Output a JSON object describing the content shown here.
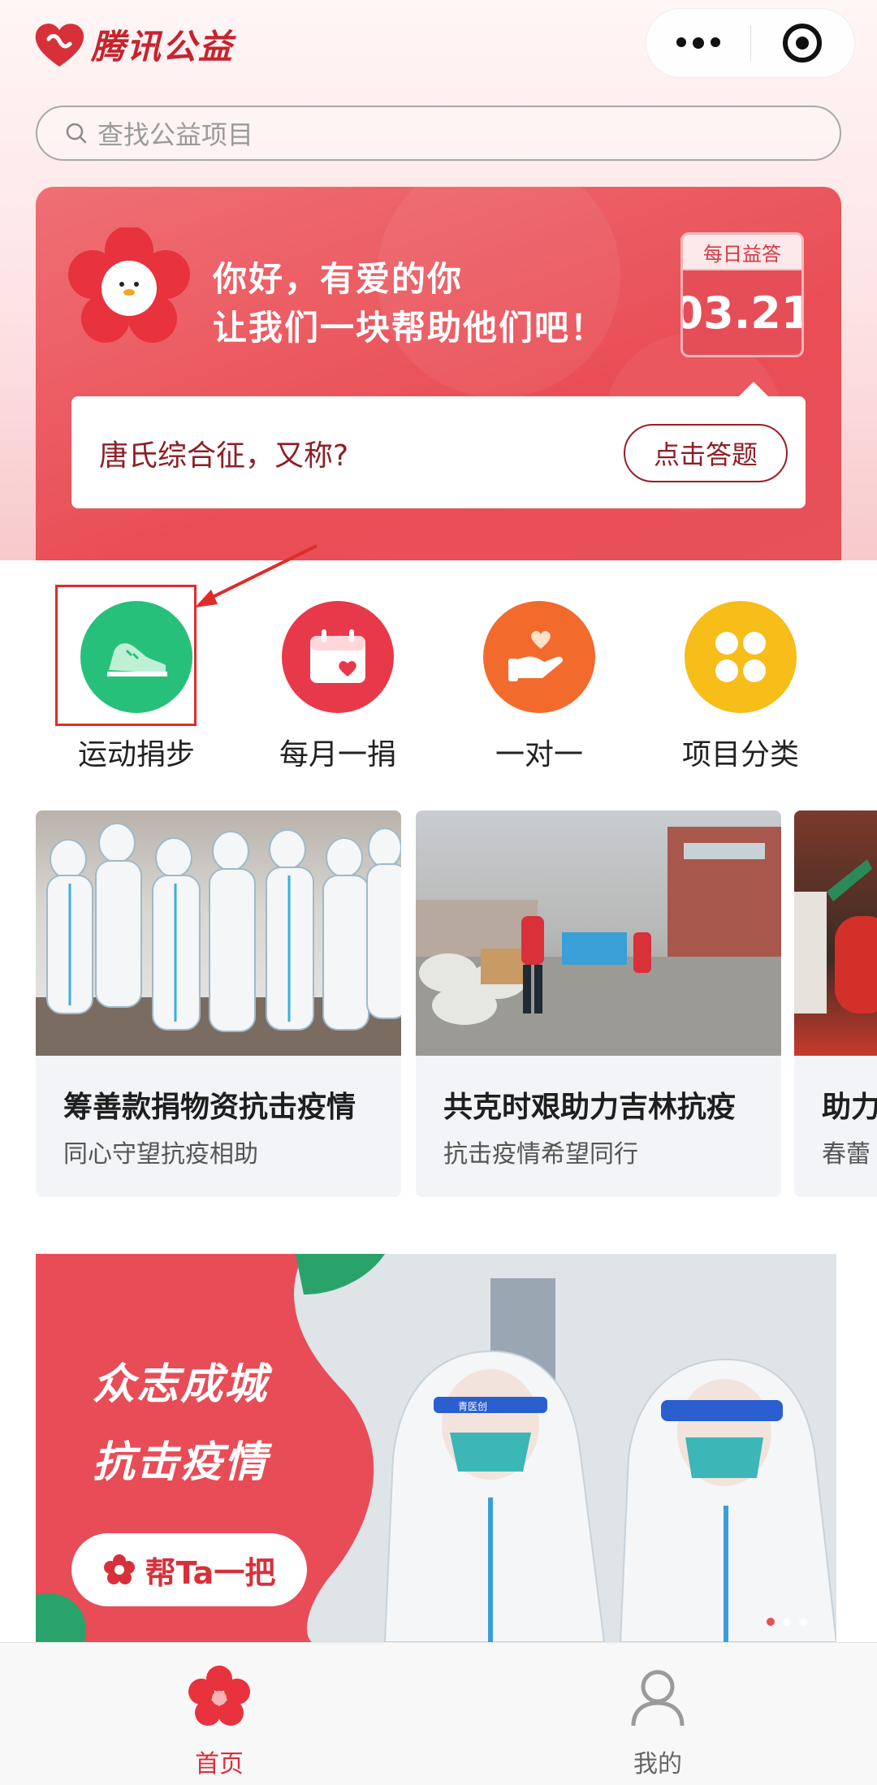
{
  "app": {
    "name": "腾讯公益"
  },
  "search": {
    "placeholder": "查找公益项目"
  },
  "greeting": {
    "line1": "你好，有爱的你",
    "line2": "让我们一块帮助他们吧！",
    "daily_label": "每日益答",
    "daily_date": "03.21",
    "question": "唐氏综合征，又称?",
    "answer_button": "点击答题"
  },
  "quick_entries": [
    {
      "label": "运动捐步",
      "icon": "sneaker-icon",
      "color": "#27c07a"
    },
    {
      "label": "每月一捐",
      "icon": "calendar-heart-icon",
      "color": "#e8394a"
    },
    {
      "label": "一对一",
      "icon": "hand-heart-icon",
      "color": "#f26b2c"
    },
    {
      "label": "项目分类",
      "icon": "clover-grid-icon",
      "color": "#f7bd19"
    }
  ],
  "projects": [
    {
      "title": "筹善款捐物资抗击疫情",
      "subtitle": "同心守望抗疫相助"
    },
    {
      "title": "共克时艰助力吉林抗疫",
      "subtitle": "抗击疫情希望同行"
    },
    {
      "title": "助力",
      "subtitle": "春蕾"
    }
  ],
  "banner": {
    "line1": "众志成城",
    "line2": "抗击疫情",
    "button": "帮Ta一把",
    "visor_text": "青医创"
  },
  "tabbar": [
    {
      "label": "首页",
      "active": true,
      "color": "#d8303a"
    },
    {
      "label": "我的",
      "active": false,
      "color": "#888888"
    }
  ],
  "colors": {
    "brand": "#d8303a",
    "highlight": "#e02b2b"
  }
}
